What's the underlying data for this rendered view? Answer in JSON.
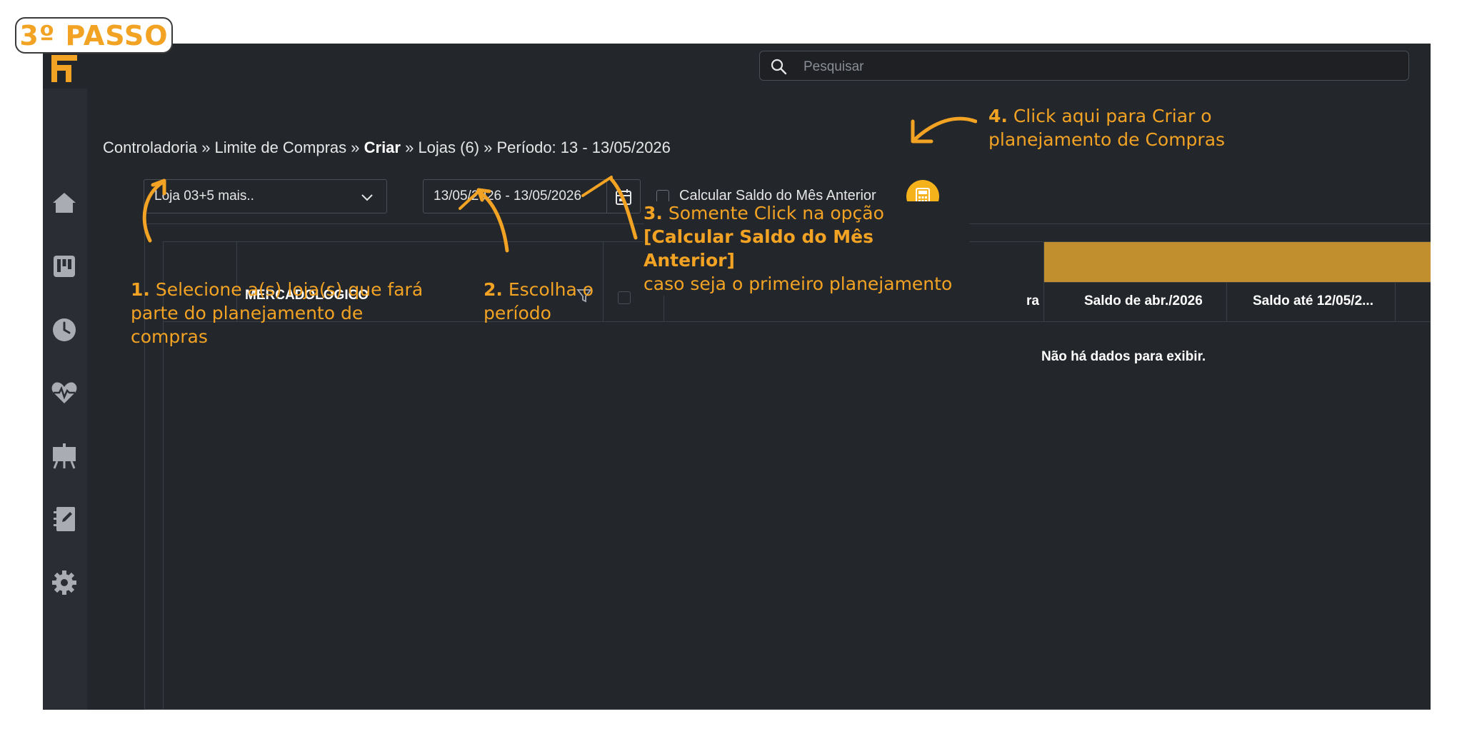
{
  "step_badge": "3º PASSO",
  "search": {
    "placeholder": "Pesquisar"
  },
  "breadcrumb": {
    "part1": "Controladoria » Limite de Compras » ",
    "bold": "Criar",
    "part2": " » Lojas (6) » Período: 13 - 13/05/2026"
  },
  "filters": {
    "store_select_value": "Loja 03+5 mais..",
    "date_range_value": "13/05/2026 - 13/05/2026",
    "checkbox_label": "Calcular Saldo do Mês Anterior"
  },
  "grid": {
    "column_title": "MERCADOLÓGICO",
    "partial_header": "ra",
    "headers": [
      "Saldo de abr./2026",
      "Saldo até 12/05/2..."
    ],
    "empty_message": "Não há dados para exibir."
  },
  "annotations": {
    "a1_num": "1.",
    "a1_text": " Selecione a(s) loja(s) que fará parte do planejamento de compras",
    "a2_num": "2.",
    "a2_text": " Escolha o período",
    "a3_num": "3.",
    "a3_line1": " Somente Click na opção",
    "a3_line2": "[Calcular Saldo do Mês Anterior]",
    "a3_line3": "caso seja o primeiro planejamento",
    "a4_num": "4.",
    "a4_text": " Click aqui para Criar o planejamento de Compras"
  },
  "colors": {
    "accent": "#f2a324",
    "button": "#f5b21b",
    "header_band": "#c28f2f",
    "background": "#23262b"
  },
  "icons": [
    "logo-icon",
    "search-icon",
    "home-icon",
    "board-icon",
    "clock-icon",
    "heart-pulse-icon",
    "presentation-icon",
    "notebook-icon",
    "gear-icon",
    "chevron-down-icon",
    "calendar-icon",
    "calculator-icon",
    "filter-icon"
  ]
}
